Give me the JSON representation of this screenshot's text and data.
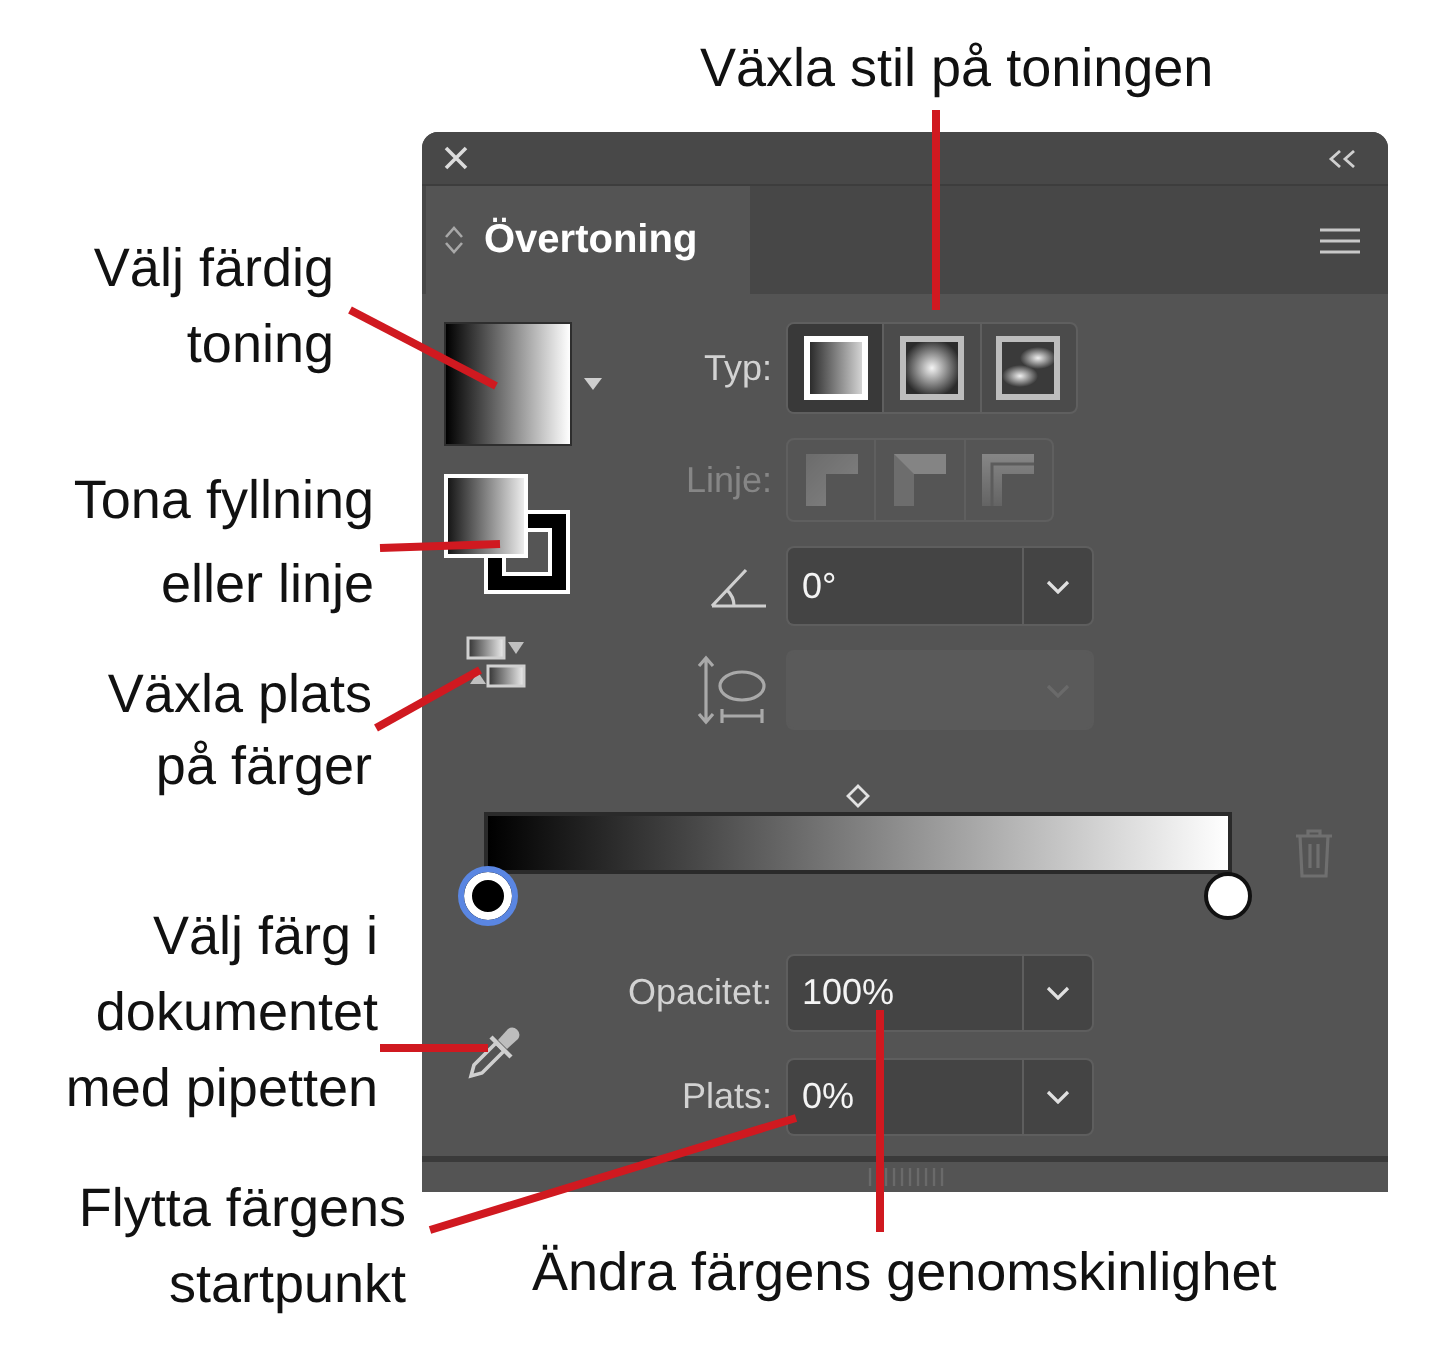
{
  "callouts": [
    {
      "lines": [
        "Växla stil på toningen"
      ]
    },
    {
      "lines": [
        "Välj färdig",
        "toning"
      ]
    },
    {
      "lines": [
        "Tona fyllning",
        "eller linje"
      ]
    },
    {
      "lines": [
        "Växla plats",
        "på färger"
      ]
    },
    {
      "lines": [
        "Välj färg i",
        "dokumentet",
        "med pipetten"
      ]
    },
    {
      "lines": [
        "Flytta färgens",
        "startpunkt"
      ]
    },
    {
      "lines": [
        "Ändra färgens genomskinlighet"
      ]
    }
  ],
  "panel": {
    "tabs": [
      {
        "label": "Övertoning",
        "selected": true
      }
    ],
    "type": {
      "label": "Typ:",
      "options": [
        {
          "kind": "linear",
          "selected": true
        },
        {
          "kind": "radial",
          "selected": false
        },
        {
          "kind": "freeform",
          "selected": false
        }
      ]
    },
    "stroke": {
      "label": "Linje:",
      "disabled": true,
      "options": [
        {
          "kind": "within"
        },
        {
          "kind": "along"
        },
        {
          "kind": "across"
        }
      ]
    },
    "angle": {
      "value": "0°"
    },
    "aspect_ratio": {
      "disabled": true
    },
    "slider": {
      "midpoint": {
        "level": 0.5
      },
      "stops": [
        {
          "level": 0,
          "color": "#000000",
          "selected": true
        },
        {
          "level": 1,
          "color": "#ffffff",
          "selected": false
        }
      ]
    },
    "delete_stop": {
      "disabled": true
    },
    "opacity": {
      "label": "Opacitet:",
      "value": "100%"
    },
    "location": {
      "label": "Plats:",
      "value": "0%"
    }
  }
}
